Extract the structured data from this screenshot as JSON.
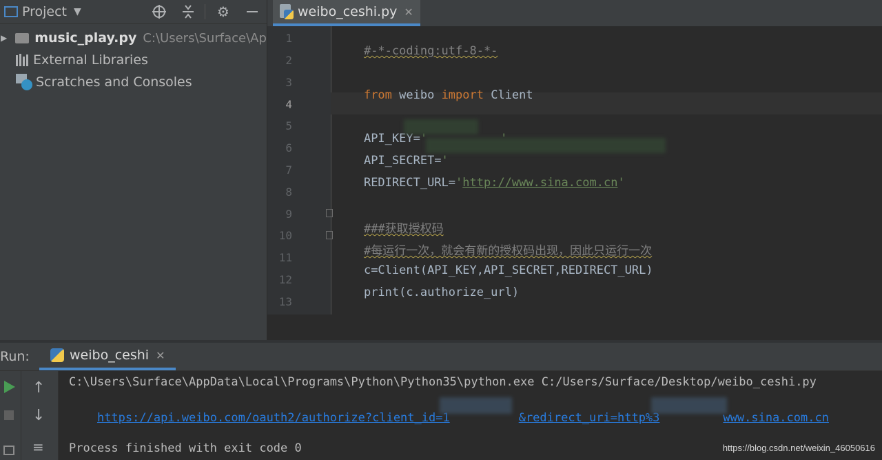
{
  "project": {
    "header_title": "Project",
    "tree": [
      {
        "name": "music_play.py",
        "path": "C:\\Users\\Surface\\AppData"
      },
      {
        "name": "External Libraries"
      },
      {
        "name": "Scratches and Consoles"
      }
    ]
  },
  "editor": {
    "tab_label": "weibo_ceshi.py",
    "line_numbers": [
      "1",
      "2",
      "3",
      "4",
      "5",
      "6",
      "7",
      "8",
      "9",
      "10",
      "11",
      "12",
      "13"
    ],
    "current_line": "4",
    "lines": {
      "l1": "#-*-coding:utf-8-*-",
      "l3_from": "from",
      "l3_module": " weibo ",
      "l3_import": "import",
      "l3_name": " Client",
      "l5_name": "API_KEY=",
      "l5_quote_open": "'",
      "l5_quote_close": "'",
      "l6_name": "API_SECRET=",
      "l6_quote_open": "'",
      "l7_name": "REDIRECT_URL=",
      "l7_quote_open": "'",
      "l7_url": "http://www.sina.com.cn",
      "l7_quote_close": "'",
      "l9": "###获取授权码",
      "l10": "#每运行一次，就会有新的授权码出现，因此只运行一次",
      "l11": "c=Client(API_KEY,API_SECRET,REDIRECT_URL)",
      "l12": "print(c.authorize_url)"
    }
  },
  "run": {
    "label": "Run:",
    "tab_label": "weibo_ceshi",
    "console": {
      "line1": "C:\\Users\\Surface\\AppData\\Local\\Programs\\Python\\Python35\\python.exe C:/Users/Surface/Desktop/weibo_ceshi.py",
      "line2_part1": "https://api.weibo.com/oauth2/authorize?client_id=1",
      "line2_part2": "&redirect_uri=http%3",
      "line2_part3": "www.sina.com.cn",
      "line4": "Process finished with exit code 0"
    }
  },
  "watermark": "https://blog.csdn.net/weixin_46050616",
  "colors": {
    "keyword": "#cc7832",
    "comment": "#808080",
    "string": "#6a8759",
    "link": "#287bde",
    "accent": "#4a88c7",
    "run_green": "#499c54"
  }
}
